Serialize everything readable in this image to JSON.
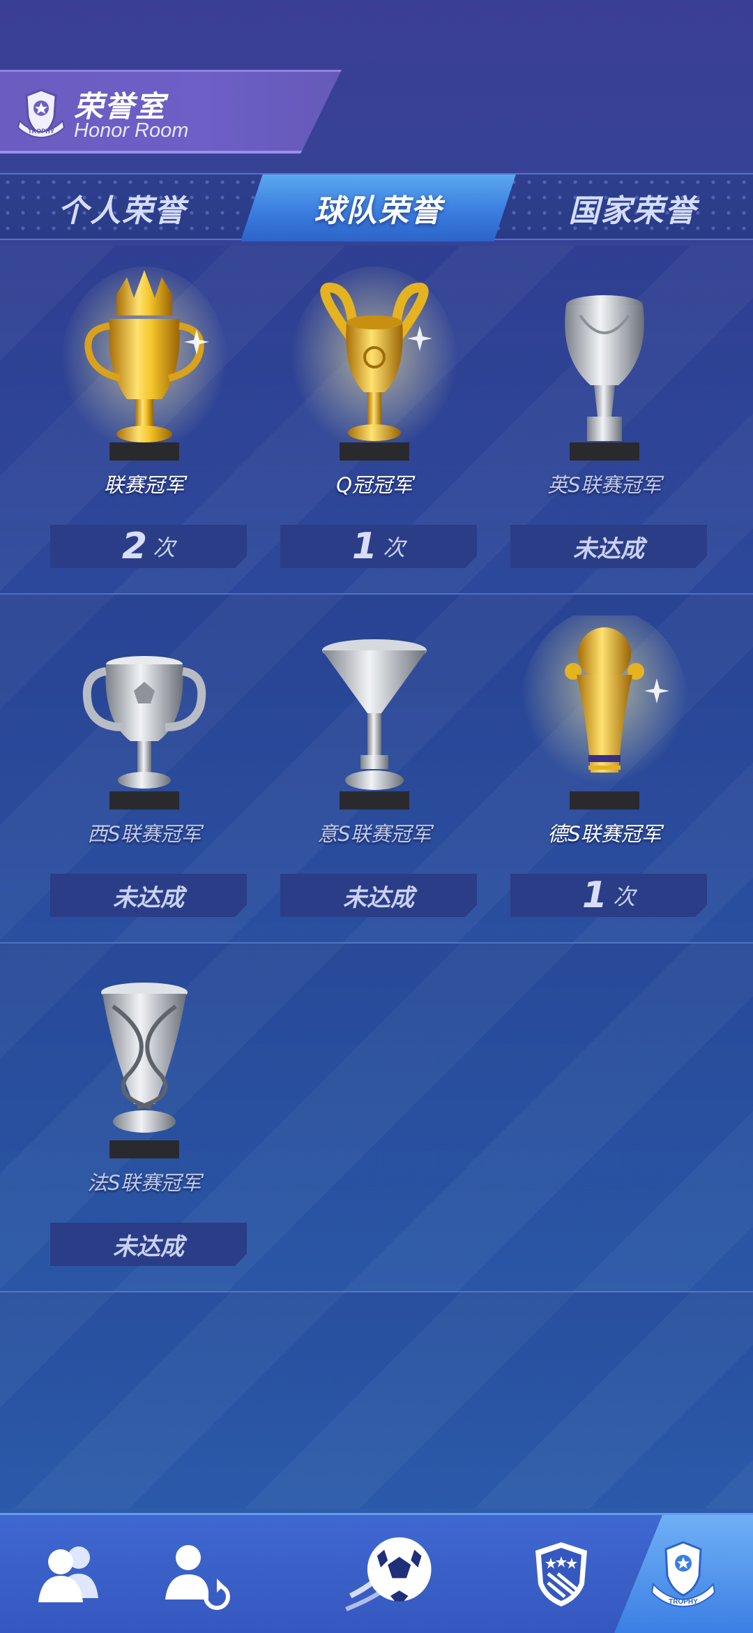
{
  "header": {
    "title": "荣誉室",
    "subtitle": "Honor Room",
    "emblem_icon": "trophy-shield-icon",
    "emblem_text": "TROPHY"
  },
  "tabs": [
    {
      "label": "个人荣誉",
      "active": false
    },
    {
      "label": "球队荣誉",
      "active": true
    },
    {
      "label": "国家荣誉",
      "active": false
    }
  ],
  "trophies": [
    {
      "name": "联赛冠军",
      "achieved": true,
      "count": "2",
      "unit": "次",
      "icon": "gold-crown-trophy-icon"
    },
    {
      "name": "Q冠冠军",
      "achieved": true,
      "count": "1",
      "unit": "次",
      "icon": "gold-big-ears-trophy-icon"
    },
    {
      "name": "英S联赛冠军",
      "achieved": false,
      "status": "未达成",
      "icon": "silver-winged-trophy-icon"
    },
    {
      "name": "西S联赛冠军",
      "achieved": false,
      "status": "未达成",
      "icon": "silver-cup-trophy-icon"
    },
    {
      "name": "意S联赛冠军",
      "achieved": false,
      "status": "未达成",
      "icon": "silver-funnel-trophy-icon"
    },
    {
      "name": "德S联赛冠军",
      "achieved": true,
      "count": "1",
      "unit": "次",
      "icon": "gold-ball-trophy-icon"
    },
    {
      "name": "法S联赛冠军",
      "achieved": false,
      "status": "未达成",
      "icon": "silver-twisted-trophy-icon"
    }
  ],
  "bottom_nav": [
    {
      "icon": "team-players-icon",
      "active": false
    },
    {
      "icon": "player-transfer-icon",
      "active": false
    },
    {
      "icon": "soccer-ball-icon",
      "active": false
    },
    {
      "icon": "club-crest-icon",
      "active": false
    },
    {
      "icon": "trophy-badge-icon",
      "active": true,
      "label": "TROPHY"
    }
  ],
  "colors": {
    "gold": "#e9b820",
    "silver": "#cfd3da",
    "active_tab": "#3b7ee0",
    "panel": "#2b3d86"
  }
}
